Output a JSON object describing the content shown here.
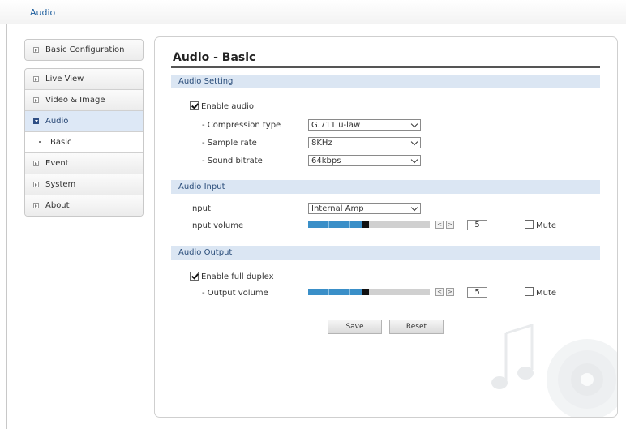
{
  "header": {
    "title": "Audio"
  },
  "sidebar": {
    "items": [
      {
        "label": "Basic Configuration"
      },
      {
        "label": "Live View"
      },
      {
        "label": "Video & Image"
      },
      {
        "label": "Audio"
      },
      {
        "label": "Basic"
      },
      {
        "label": "Event"
      },
      {
        "label": "System"
      },
      {
        "label": "About"
      }
    ]
  },
  "main": {
    "title": "Audio - Basic",
    "audio_setting": {
      "header": "Audio Setting",
      "enable_label": "Enable audio",
      "enable_checked": true,
      "compression_label": "- Compression type",
      "compression_value": "G.711 u-law",
      "sample_rate_label": "- Sample rate",
      "sample_rate_value": "8KHz",
      "bitrate_label": "- Sound bitrate",
      "bitrate_value": "64kbps"
    },
    "audio_input": {
      "header": "Audio Input",
      "input_label": "Input",
      "input_value": "Internal Amp",
      "volume_label": "Input volume",
      "volume_value": "5",
      "volume_level": 0.5,
      "mute_label": "Mute",
      "mute_checked": false
    },
    "audio_output": {
      "header": "Audio Output",
      "duplex_label": "Enable full duplex",
      "duplex_checked": true,
      "volume_label": "- Output volume",
      "volume_value": "5",
      "volume_level": 0.5,
      "mute_label": "Mute",
      "mute_checked": false
    },
    "buttons": {
      "save": "Save",
      "reset": "Reset"
    },
    "slider_left_glyph": "<",
    "slider_right_glyph": ">"
  },
  "colors": {
    "link": "#1f5f9e",
    "section_bg": "#dbe6f3",
    "slider_fill": "#3a8fc8",
    "slider_track": "#d0d0d0",
    "slider_thumb": "#111111"
  }
}
